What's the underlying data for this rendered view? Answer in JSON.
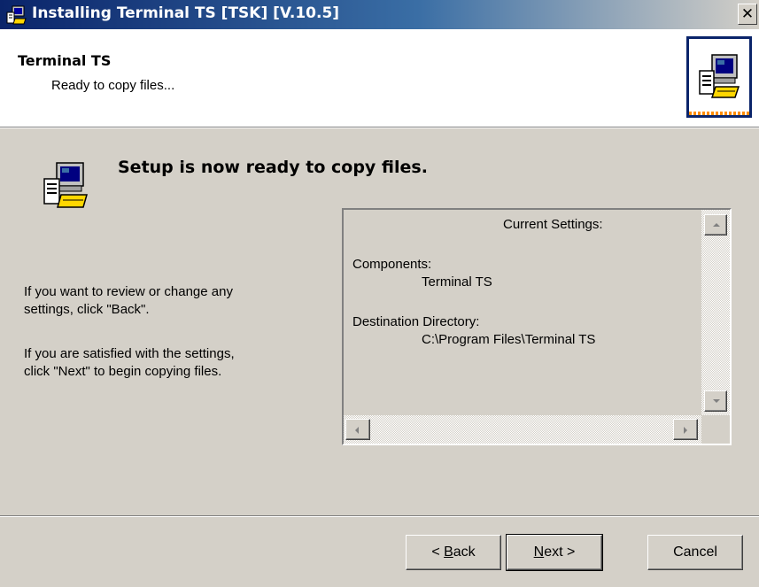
{
  "window": {
    "title": "Installing Terminal TS [TSK] [V.10.5]",
    "close_glyph": "✕"
  },
  "header": {
    "title": "Terminal TS",
    "subtitle": "Ready to copy files..."
  },
  "main": {
    "heading": "Setup is now ready to copy files.",
    "instructions": [
      "If you want to review or change any",
      "settings, click \"Back\".",
      "If you are satisfied with the settings,",
      "click \"Next\" to begin copying files."
    ]
  },
  "settings": {
    "header": "Current Settings:",
    "components_label": "Components:",
    "components_value": "Terminal TS",
    "destination_label": "Destination Directory:",
    "destination_value": "C:\\Program Files\\Terminal TS"
  },
  "buttons": {
    "back_prefix": "< ",
    "back_mnemonic": "B",
    "back_rest": "ack",
    "next_mnemonic": "N",
    "next_rest": "ext >",
    "cancel": "Cancel"
  },
  "icons": {
    "title_icon": "installer-icon",
    "header_icon": "computer-install-icon",
    "main_icon": "computer-install-icon"
  }
}
